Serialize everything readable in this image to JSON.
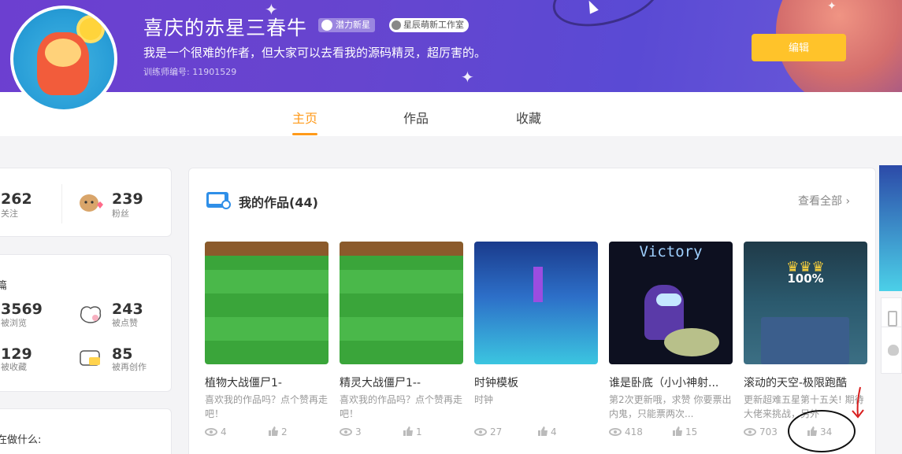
{
  "profile": {
    "username": "喜庆的赤星三春牛",
    "badge_potential": "潜力新星",
    "badge_studio": "星辰萌新工作室",
    "intro": "我是一个很难的作者，但大家可以去看我的源码精灵，超厉害的。",
    "trainer_id": "训练师编号: 11901529",
    "edit_label": "编辑"
  },
  "tabs": [
    {
      "label": "主页",
      "active": true
    },
    {
      "label": "作品",
      "active": false
    },
    {
      "label": "收藏",
      "active": false
    }
  ],
  "stats": {
    "following": {
      "value": "262",
      "label": "关注"
    },
    "fans": {
      "value": "239",
      "label": "粉丝"
    },
    "section_label": "篇",
    "views": {
      "value": "3569",
      "label": "被浏览"
    },
    "likes": {
      "value": "243",
      "label": "被点赞"
    },
    "collected": {
      "value": "129",
      "label": "被收藏"
    },
    "remixed": {
      "value": "85",
      "label": "被再创作"
    },
    "doing_label": "在做什么:"
  },
  "works": {
    "title": "我的作品(44)",
    "view_all": "查看全部",
    "items": [
      {
        "title": "植物大战僵尸1-",
        "desc": "喜欢我的作品吗？点个赞再走吧！",
        "views": "4",
        "likes": "2",
        "theme": "grass"
      },
      {
        "title": "精灵大战僵尸1--",
        "desc": "喜欢我的作品吗？点个赞再走吧！",
        "views": "3",
        "likes": "1",
        "theme": "grass"
      },
      {
        "title": "时钟模板",
        "desc": "时钟",
        "views": "27",
        "likes": "4",
        "theme": "hex"
      },
      {
        "title": "谁是卧底（小小神射...",
        "desc": "第2次更新哦，求赞 你要票出内鬼，只能票两次...",
        "views": "418",
        "likes": "15",
        "theme": "victory",
        "thumb_text": "Victory"
      },
      {
        "title": "滚动的天空-极限跑酷",
        "desc": "更新超难五星第十五关! 期待大佬来挑战，另外",
        "views": "703",
        "likes": "34",
        "theme": "sky",
        "thumb_text": "100%"
      }
    ]
  },
  "colors": {
    "accent": "#ff9a1a",
    "edit_button": "#ffc32a",
    "banner": "#6645cf"
  }
}
